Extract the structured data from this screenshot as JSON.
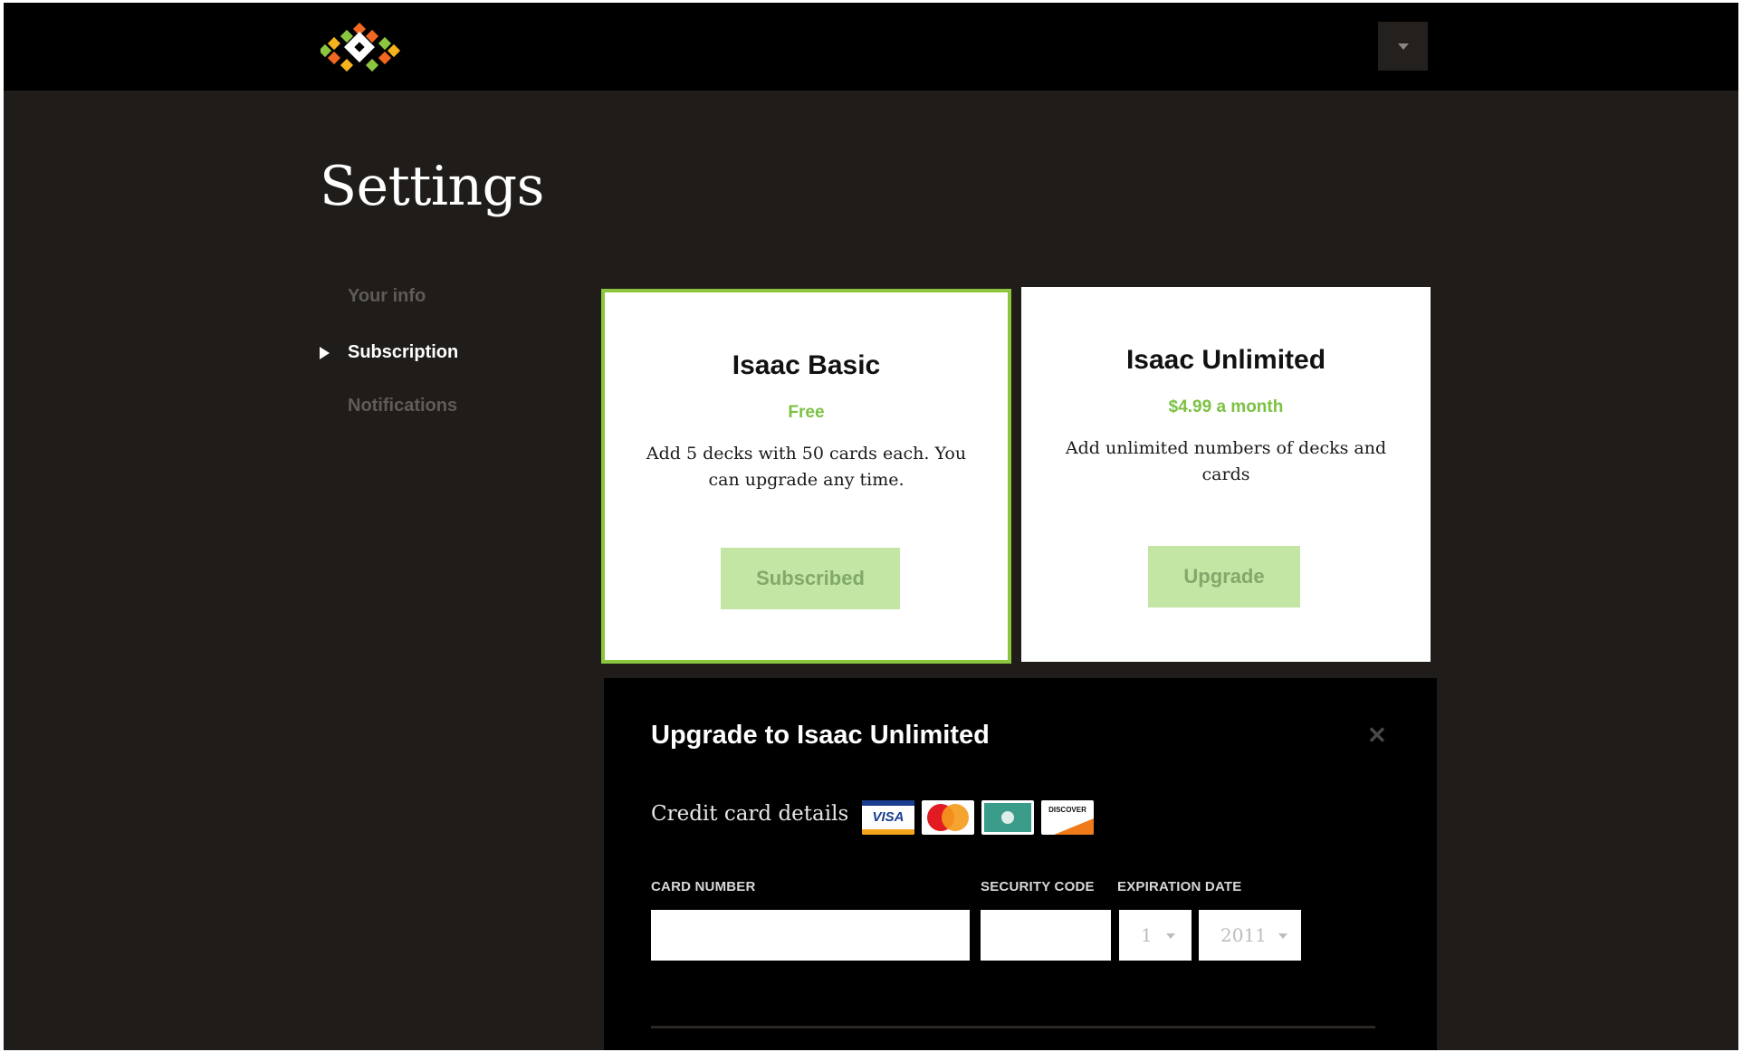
{
  "header": {
    "logo_icon": "diamond-mosaic-logo",
    "menu_icon": "chevron-down-icon"
  },
  "page": {
    "title": "Settings"
  },
  "sidebar": {
    "items": [
      {
        "label": "Your info",
        "active": false
      },
      {
        "label": "Subscription",
        "active": true
      },
      {
        "label": "Notifications",
        "active": false
      }
    ]
  },
  "plans": [
    {
      "name": "Isaac Basic",
      "price": "Free",
      "description": "Add 5 decks with 50 cards each. You can upgrade any time.",
      "button_label": "Subscribed",
      "selected": true
    },
    {
      "name": "Isaac Unlimited",
      "price": "$4.99 a month",
      "description": "Add unlimited numbers of decks and cards",
      "button_label": "Upgrade",
      "selected": false
    }
  ],
  "upgrade_panel": {
    "title": "Upgrade to Isaac Unlimited",
    "close_icon": "close-icon",
    "credit_card_label": "Credit card details",
    "card_brands": [
      "VISA",
      "MasterCard",
      "American Express",
      "DISCOVER"
    ],
    "card_number_label": "CARD NUMBER",
    "card_number_value": "",
    "security_code_label": "SECURITY CODE",
    "security_code_value": "",
    "expiration_label": "EXPIRATION DATE",
    "expiration_month": "1",
    "expiration_year": "2011"
  },
  "colors": {
    "accent_green": "#8cc63f",
    "price_green": "#7cc242",
    "button_green": "#c3e6a5",
    "background": "#1f1c1a",
    "topbar": "#000000"
  }
}
